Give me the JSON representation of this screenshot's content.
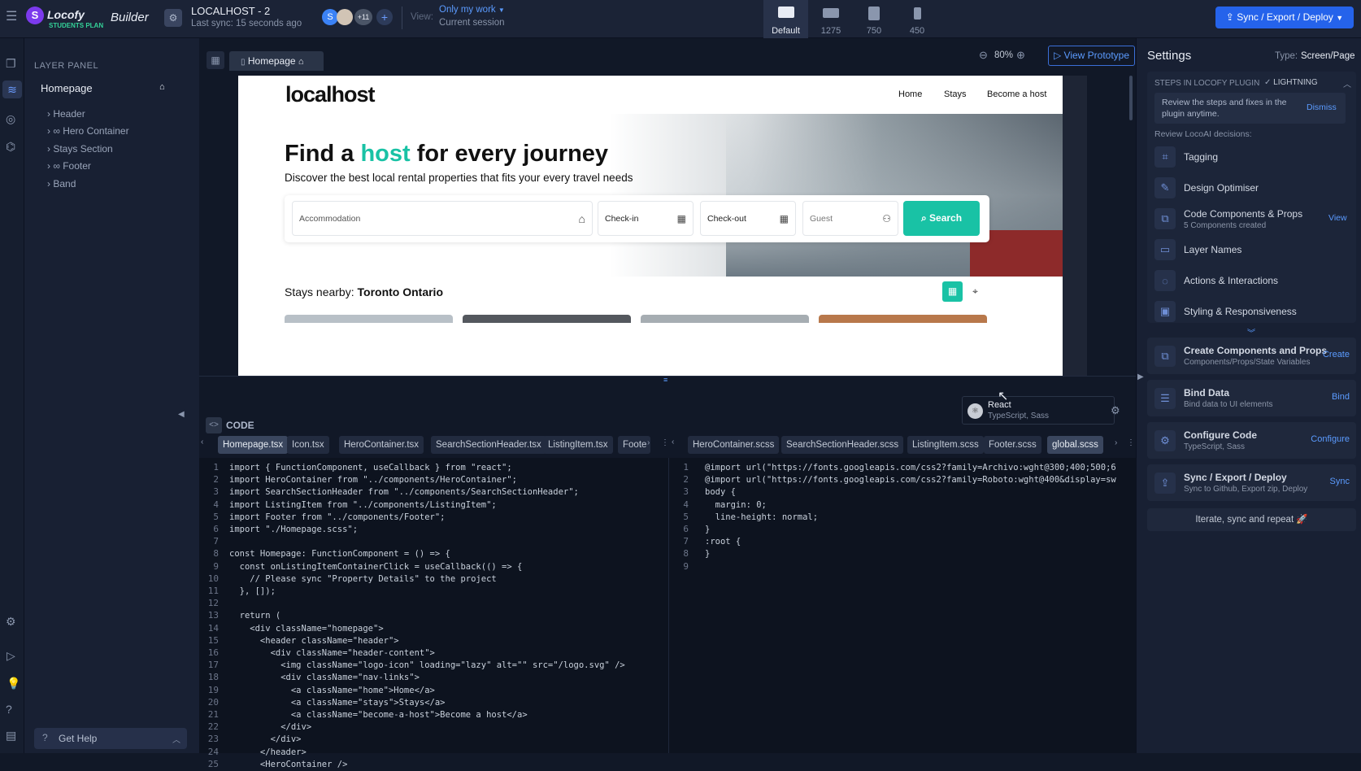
{
  "topbar": {
    "app_name": "Locofy",
    "plan": "STUDENTS PLAN",
    "mode": "Builder",
    "project_name": "LOCALHOST - 2",
    "last_sync": "Last sync: 15 seconds ago",
    "avatar_initial": "S",
    "collaborators_more": "+11",
    "view_label": "View:",
    "view_value": "Only my work",
    "view_sub": "Current session",
    "breakpoints": [
      {
        "label": "Default"
      },
      {
        "label": "1275"
      },
      {
        "label": "750"
      },
      {
        "label": "450"
      }
    ],
    "sync_button": "Sync / Export / Deploy"
  },
  "layer_panel": {
    "title": "LAYER PANEL",
    "page": "Homepage",
    "items": [
      {
        "label": "Header"
      },
      {
        "label": "Hero Container"
      },
      {
        "label": "Stays Section"
      },
      {
        "label": "Footer"
      },
      {
        "label": "Band"
      }
    ],
    "help": "Get Help"
  },
  "canvas": {
    "tab": "Homepage",
    "zoom": "80%",
    "view_prototype": "View Prototype"
  },
  "site": {
    "logo": "localhost",
    "nav": [
      "Home",
      "Stays",
      "Become a host"
    ],
    "hero_title_pre": "Find a ",
    "hero_title_accent": "host",
    "hero_title_post": " for every journey",
    "hero_subtitle": "Discover the best local rental properties that fits your every travel needs",
    "search_fields": [
      "Accommodation",
      "Check-in",
      "Check-out",
      "Guest"
    ],
    "search_button": "Search",
    "stays_label": "Stays nearby: ",
    "stays_location": "Toronto Ontario"
  },
  "code": {
    "title": "CODE",
    "framework": "React",
    "framework_sub": "TypeScript, Sass",
    "left_tabs": [
      "Homepage.tsx",
      "Icon.tsx",
      "HeroContainer.tsx",
      "SearchSectionHeader.tsx",
      "ListingItem.tsx",
      "Foote"
    ],
    "right_tabs": [
      "HeroContainer.scss",
      "SearchSectionHeader.scss",
      "ListingItem.scss",
      "Footer.scss",
      "global.scss"
    ],
    "left_lines": [
      "import { FunctionComponent, useCallback } from \"react\";",
      "import HeroContainer from \"../components/HeroContainer\";",
      "import SearchSectionHeader from \"../components/SearchSectionHeader\";",
      "import ListingItem from \"../components/ListingItem\";",
      "import Footer from \"../components/Footer\";",
      "import \"./Homepage.scss\";",
      "",
      "const Homepage: FunctionComponent = () => {",
      "  const onListingItemContainerClick = useCallback(() => {",
      "    // Please sync \"Property Details\" to the project",
      "  }, []);",
      "",
      "  return (",
      "    <div className=\"homepage\">",
      "      <header className=\"header\">",
      "        <div className=\"header-content\">",
      "          <img className=\"logo-icon\" loading=\"lazy\" alt=\"\" src=\"/logo.svg\" />",
      "          <div className=\"nav-links\">",
      "            <a className=\"home\">Home</a>",
      "            <a className=\"stays\">Stays</a>",
      "            <a className=\"become-a-host\">Become a host</a>",
      "          </div>",
      "        </div>",
      "      </header>",
      "      <HeroContainer />"
    ],
    "right_lines": [
      "@import url(\"https://fonts.googleapis.com/css2?family=Archivo:wght@300;400;500;6",
      "@import url(\"https://fonts.googleapis.com/css2?family=Roboto:wght@400&display=sw",
      "body {",
      "  margin: 0;",
      "  line-height: normal;",
      "}",
      ":root {",
      "}",
      ""
    ]
  },
  "settings": {
    "title": "Settings",
    "type_label": "Type:",
    "type_value": "Screen/Page",
    "steps_label": "STEPS IN LOCOFY PLUGIN",
    "lightning": "LIGHTNING",
    "notice": "Review the steps and fixes in the plugin anytime.",
    "dismiss": "Dismiss",
    "review_label": "Review LocoAI decisions:",
    "decisions": [
      {
        "label": "Tagging",
        "sub": "",
        "action": ""
      },
      {
        "label": "Design Optimiser",
        "sub": "",
        "action": ""
      },
      {
        "label": "Code Components & Props",
        "sub": "5 Components created",
        "action": "View"
      },
      {
        "label": "Layer Names",
        "sub": "",
        "action": ""
      },
      {
        "label": "Actions & Interactions",
        "sub": "",
        "action": ""
      },
      {
        "label": "Styling & Responsiveness",
        "sub": "",
        "action": ""
      }
    ],
    "cards": [
      {
        "label": "Create Components and Props",
        "sub": "Components/Props/State Variables",
        "action": "Create"
      },
      {
        "label": "Bind Data",
        "sub": "Bind data to UI elements",
        "action": "Bind"
      },
      {
        "label": "Configure Code",
        "sub": "TypeScript, Sass",
        "action": "Configure"
      },
      {
        "label": "Sync / Export / Deploy",
        "sub": "Sync to Github, Export zip, Deploy",
        "action": "Sync"
      }
    ],
    "footer": "Iterate, sync and repeat 🚀"
  },
  "colors": {
    "accent": "#2563eb",
    "brand_teal": "#19c2a5",
    "sidebar": "#182033"
  }
}
